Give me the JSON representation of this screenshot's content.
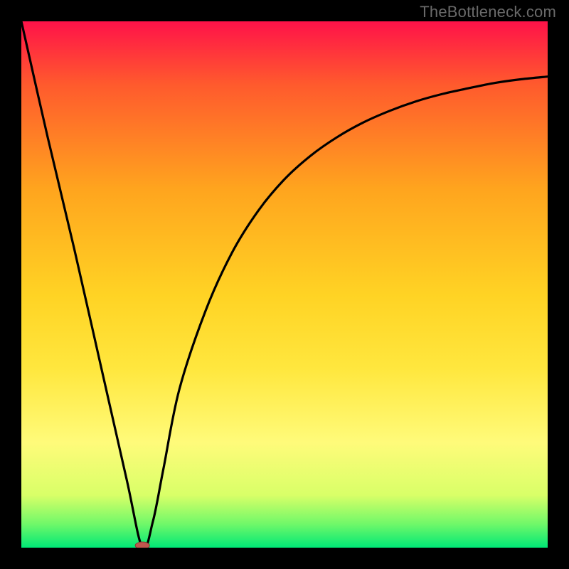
{
  "watermark": "TheBottleneck.com",
  "chart_data": {
    "type": "line",
    "title": "",
    "xlabel": "",
    "ylabel": "",
    "xlim": [
      0,
      100
    ],
    "ylim": [
      0,
      100
    ],
    "grid": false,
    "legend": false,
    "background_gradient_colors": [
      "#ff1249",
      "#ff5a2d",
      "#ffa51e",
      "#ffd324",
      "#ffe73e",
      "#fffb7a",
      "#d9ff68",
      "#70f869",
      "#00e876"
    ],
    "series": [
      {
        "name": "curve",
        "color": "#000000",
        "x": [
          0,
          5,
          10,
          15,
          20,
          23,
          25,
          27,
          30,
          35,
          40,
          45,
          50,
          55,
          60,
          65,
          70,
          75,
          80,
          85,
          90,
          95,
          100
        ],
        "values": [
          100,
          78,
          57,
          35,
          13,
          0,
          5,
          15,
          30,
          45,
          56,
          64,
          70,
          74.5,
          78,
          80.8,
          83,
          84.8,
          86.2,
          87.3,
          88.3,
          89,
          89.5
        ]
      }
    ],
    "marker": {
      "name": "minimum-marker",
      "x": 23,
      "y": 0,
      "color": "#c0564e",
      "rx": 10,
      "ry": 5
    }
  }
}
